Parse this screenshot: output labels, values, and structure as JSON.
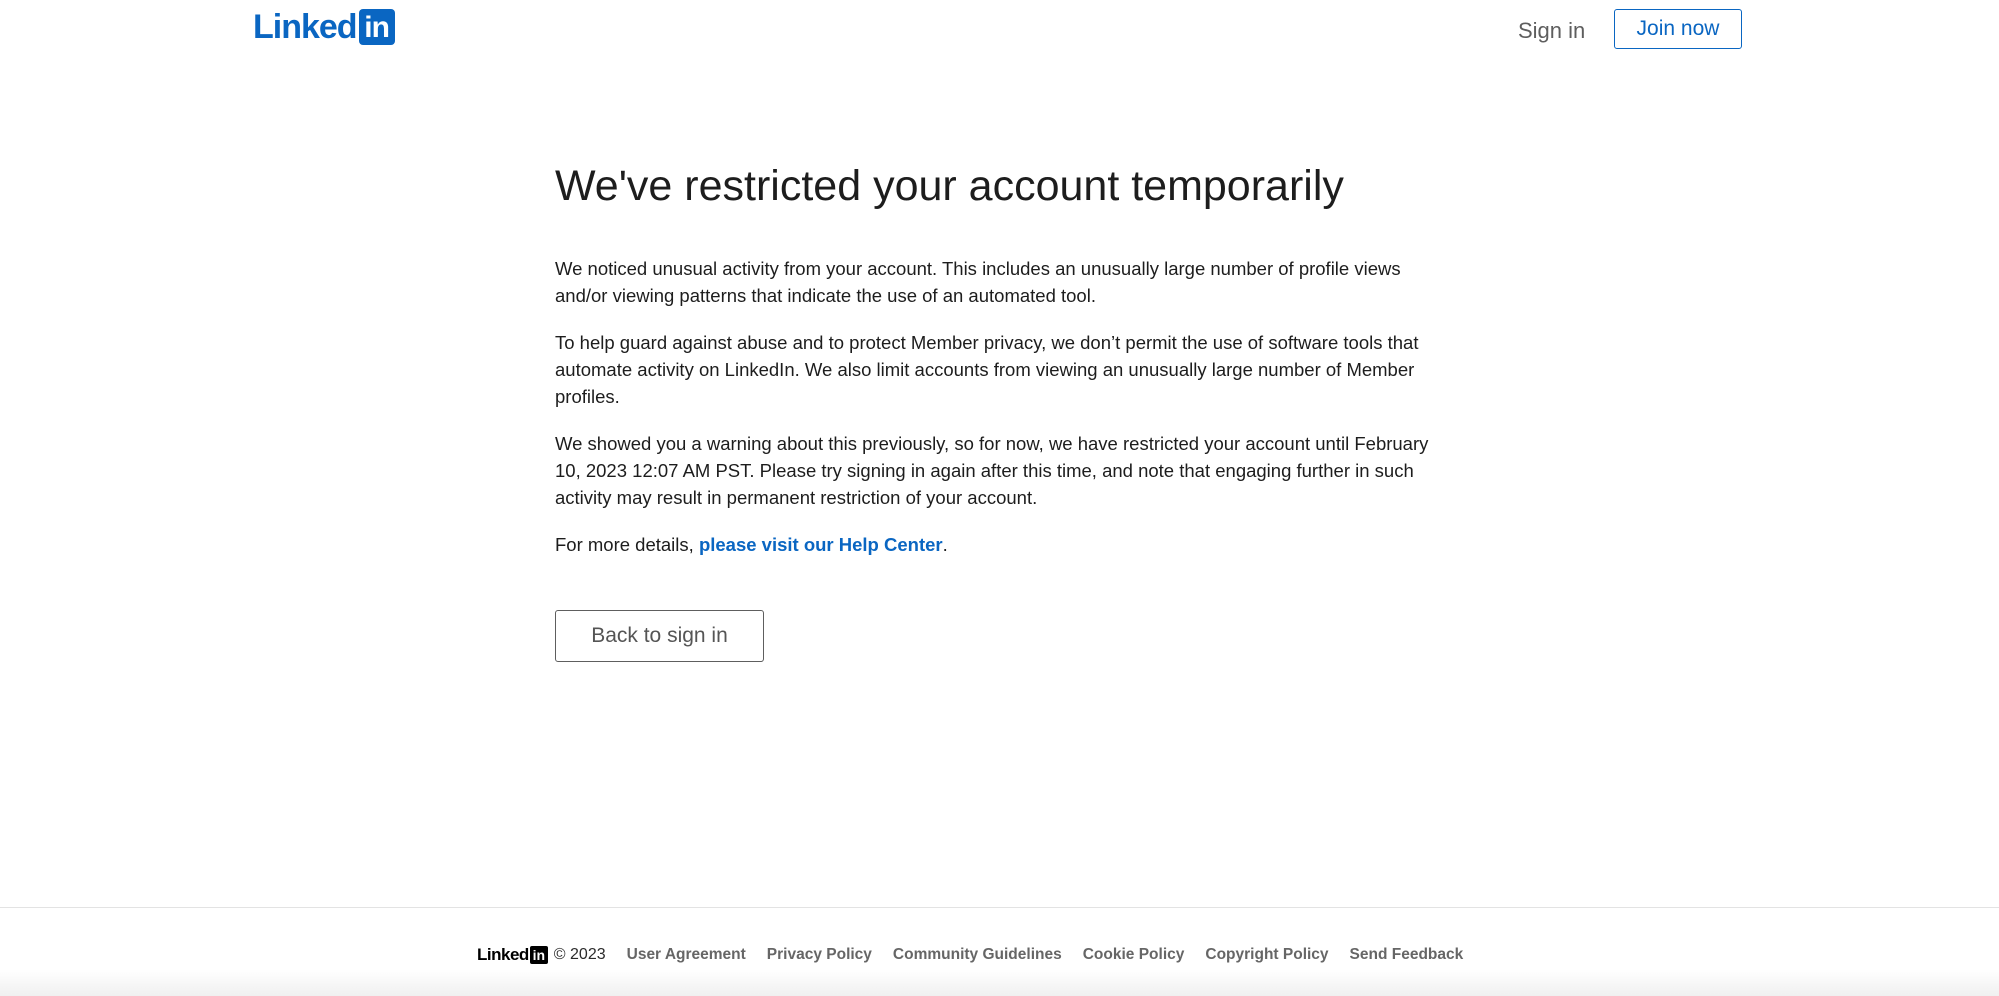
{
  "header": {
    "logo_text": "Linked",
    "logo_box_text": "in",
    "sign_in_label": "Sign in",
    "join_now_label": "Join now"
  },
  "main": {
    "title": "We've restricted your account temporarily",
    "paragraph_1": "We noticed unusual activity from your account. This includes an unusually large number of profile views and/or viewing patterns that indicate the use of an automated tool.",
    "paragraph_2": "To help guard against abuse and to protect Member privacy, we don’t permit the use of software tools that automate activity on LinkedIn. We also limit accounts from viewing an unusually large number of Member profiles.",
    "paragraph_3": "We showed you a warning about this previously, so for now, we have restricted your account until February 10, 2023 12:07 AM PST. Please try signing in again after this time, and note that engaging further in such activity may result in permanent restriction of your account.",
    "details_prefix": "For more details, ",
    "help_link_text": "please visit our Help Center",
    "details_suffix": ".",
    "back_button_label": "Back to sign in"
  },
  "footer": {
    "logo_text": "Linked",
    "logo_box_text": "in",
    "copyright": "© 2023",
    "links": [
      "User Agreement",
      "Privacy Policy",
      "Community Guidelines",
      "Cookie Policy",
      "Copyright Policy",
      "Send Feedback"
    ]
  },
  "colors": {
    "brand_blue": "#0a66c2",
    "text_primary": "#1d1d1d",
    "text_muted": "#666666"
  }
}
